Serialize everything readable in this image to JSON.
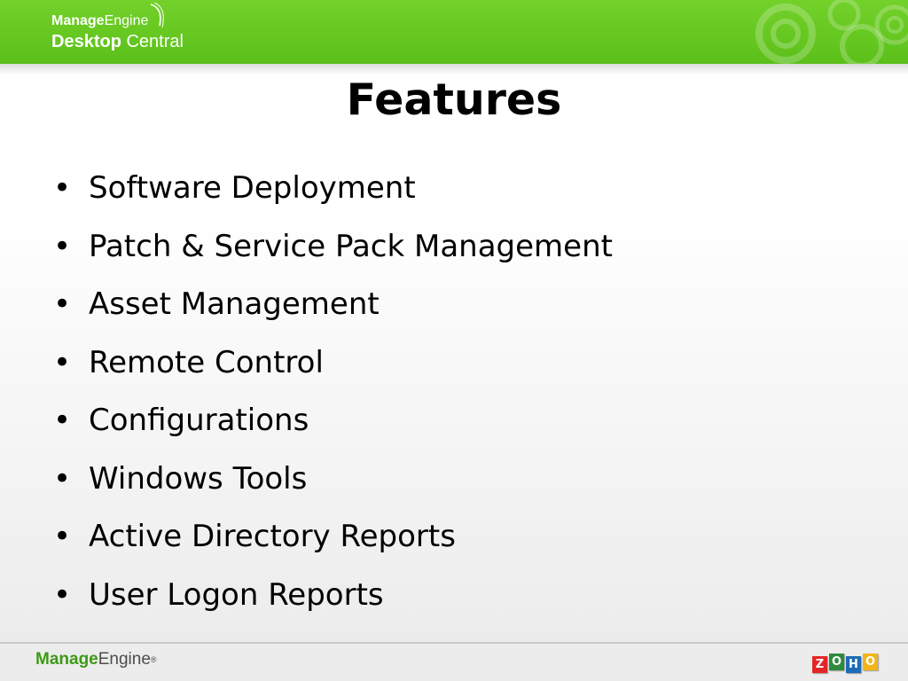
{
  "header": {
    "brand_bold": "Manage",
    "brand_light": "Engine",
    "product_bold": "Desktop",
    "product_light": " Central",
    "accent_color": "#66c91f"
  },
  "slide": {
    "title": "Features",
    "bullet_glyph": "•",
    "bullets": [
      "Software Deployment",
      "Patch & Service Pack Management",
      "Asset Management",
      "Remote Control",
      "Configurations",
      "Windows Tools",
      "Active Directory Reports",
      "User Logon Reports"
    ]
  },
  "footer": {
    "brand_bold": "Manage",
    "brand_light": "Engine",
    "registered_mark": "®",
    "zoho_letters": [
      "Z",
      "O",
      "H",
      "O"
    ],
    "zoho_colors": [
      "#e42527",
      "#2e8b3d",
      "#1d6bb5",
      "#f1b51a"
    ]
  }
}
